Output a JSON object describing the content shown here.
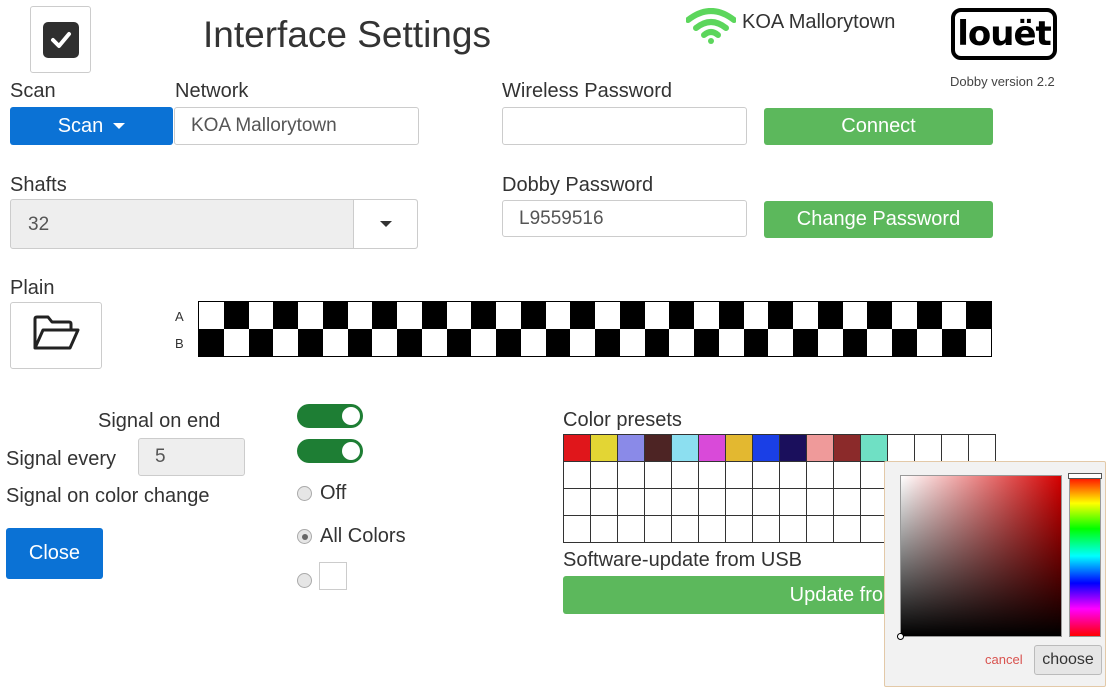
{
  "header": {
    "title": "Interface Settings",
    "network_status": "KOA Mallorytown",
    "logo_text": "louët",
    "version": "Dobby version 2.2"
  },
  "scan": {
    "label": "Scan",
    "button": "Scan"
  },
  "network": {
    "label": "Network",
    "value": "KOA Mallorytown"
  },
  "wireless_password": {
    "label": "Wireless Password",
    "value": "",
    "connect": "Connect"
  },
  "shafts": {
    "label": "Shafts",
    "value": "32"
  },
  "dobby_password": {
    "label": "Dobby Password",
    "value": "L9559516",
    "change": "Change Password"
  },
  "plain": {
    "label": "Plain",
    "row_labels": [
      "A",
      "B"
    ],
    "row_a_first_black": false
  },
  "signal": {
    "signal_on_end": "Signal on end",
    "signal_every": "Signal every",
    "signal_every_value": "5",
    "signal_on_color_change": "Signal on color change",
    "toggle_end_on": true,
    "toggle_every_on": true,
    "radio_off": "Off",
    "radio_all_colors": "All Colors",
    "selected": "All Colors"
  },
  "close": "Close",
  "color_presets": {
    "label": "Color presets",
    "colors": [
      "#e0161b",
      "#e3d534",
      "#8a8ae8",
      "#4d2424",
      "#8cdff0",
      "#d94ad9",
      "#e3b830",
      "#1a3fe6",
      "#1a0f5c",
      "#ef9a9a",
      "#8b2a2a",
      "#6fe0c4"
    ],
    "columns": 16,
    "rows": 4
  },
  "software_update": {
    "label": "Software-update from USB",
    "button": "Update from USB"
  },
  "color_picker": {
    "cancel": "cancel",
    "choose": "choose"
  },
  "colors": {
    "blue": "#0b72d5",
    "green": "#5cb85c",
    "toggle": "#1e7e34"
  }
}
